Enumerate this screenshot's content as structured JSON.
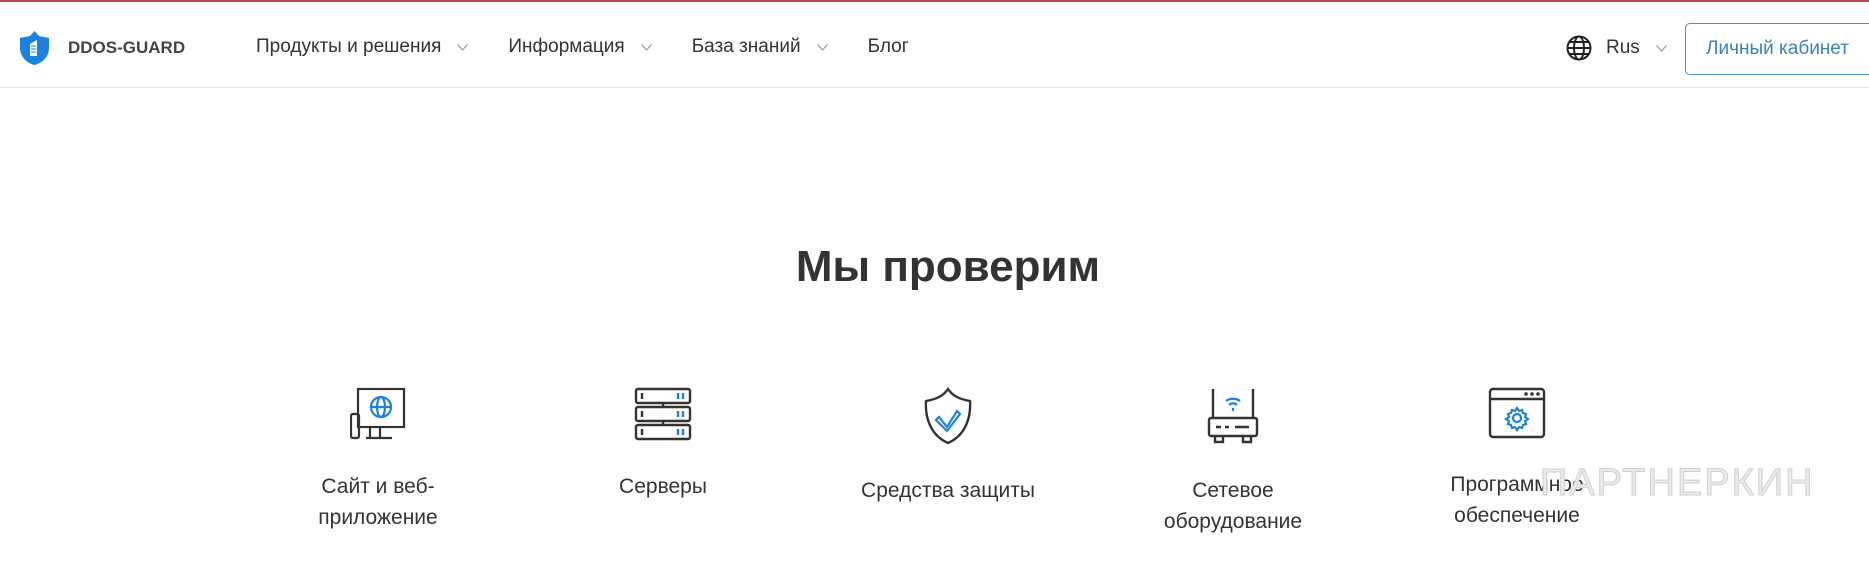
{
  "header": {
    "logo_text": "DDOS-GUARD",
    "nav": [
      {
        "label": "Продукты и решения",
        "dropdown": true
      },
      {
        "label": "Информация",
        "dropdown": true
      },
      {
        "label": "База знаний",
        "dropdown": true
      },
      {
        "label": "Блог",
        "dropdown": false
      }
    ],
    "language": "Rus",
    "account_button": "Личный кабинет"
  },
  "colors": {
    "accent": "#1a82e2",
    "top_line": "#b5484b",
    "button_border": "#4a8fc9"
  },
  "main": {
    "title": "Мы проверим",
    "items": [
      {
        "icon": "monitor-globe-icon",
        "line1": "Сайт и веб-",
        "line2": "приложение"
      },
      {
        "icon": "server-icon",
        "line1": "Серверы",
        "line2": ""
      },
      {
        "icon": "shield-check-icon",
        "line1": "Средства защиты",
        "line2": ""
      },
      {
        "icon": "router-icon",
        "line1": "Сетевое",
        "line2": "оборудование"
      },
      {
        "icon": "software-gear-icon",
        "line1": "Программное",
        "line2": "обеспечение"
      }
    ]
  },
  "watermark": "ПАРТНЕРКИН"
}
